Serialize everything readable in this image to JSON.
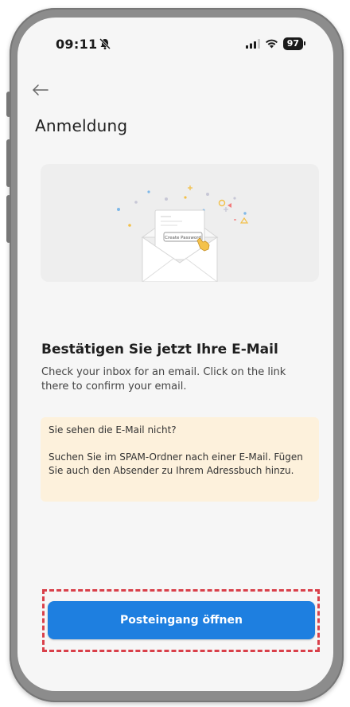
{
  "status_bar": {
    "time": "09:11",
    "battery": "97",
    "icons": [
      "mute-icon",
      "signal-icon",
      "wifi-icon",
      "battery-icon"
    ]
  },
  "header": {
    "back_icon": "arrow-left-icon",
    "title": "Anmeldung"
  },
  "illustration": {
    "icon": "open-envelope-illustration",
    "card_button_label": "Create Password"
  },
  "content": {
    "heading": "Bestätigen Sie jetzt Ihre E-Mail",
    "description": "Check your inbox for an email. Click on the link there to confirm your email."
  },
  "notice": {
    "heading": "Sie sehen die E-Mail nicht?",
    "text": "Suchen Sie im SPAM-Ordner nach einer E-Mail. Fügen Sie auch den Absender zu Ihrem Adressbuch hinzu.",
    "background": "#fdf1dc"
  },
  "actions": {
    "open_inbox_label": "Posteingang öffnen",
    "accent": "#1e7fe0"
  },
  "colors": {
    "screen_background": "#f6f6f6",
    "frame": "#8c8c8c",
    "highlight": "#d9404a"
  }
}
